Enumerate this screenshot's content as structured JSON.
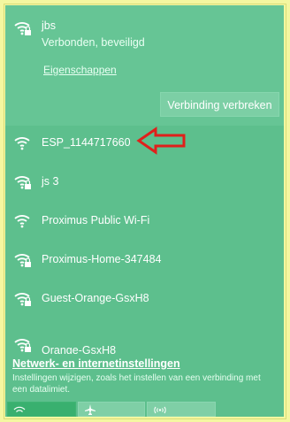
{
  "connected": {
    "ssid": "jbs",
    "status": "Verbonden, beveiligd",
    "properties_link": "Eigenschappen",
    "disconnect_button": "Verbinding verbreken"
  },
  "networks": [
    {
      "ssid": "ESP_1144717660",
      "secured": false
    },
    {
      "ssid": "js 3",
      "secured": true
    },
    {
      "ssid": "Proximus Public Wi-Fi",
      "secured": false
    },
    {
      "ssid": "Proximus-Home-347484",
      "secured": true
    },
    {
      "ssid": "Guest-Orange-GsxH8",
      "secured": true
    },
    {
      "ssid": "Orange-GsxH8",
      "secured": true
    }
  ],
  "footer": {
    "settings_link": "Netwerk- en internetinstellingen",
    "settings_desc": "Instellingen wijzigen, zoals het instellen van een verbinding met een datalimiet."
  },
  "quick_tiles": [
    {
      "name": "wifi-tile",
      "icon": "wifi-icon",
      "active": true
    },
    {
      "name": "airplane-mode-tile",
      "icon": "airplane-icon",
      "active": false
    },
    {
      "name": "mobile-hotspot-tile",
      "icon": "hotspot-icon",
      "active": false
    }
  ],
  "colors": {
    "panel": "#5dbf8d",
    "highlight": "#66c595",
    "annotation_arrow": "#e0201b",
    "background": "#f4f7a0"
  }
}
